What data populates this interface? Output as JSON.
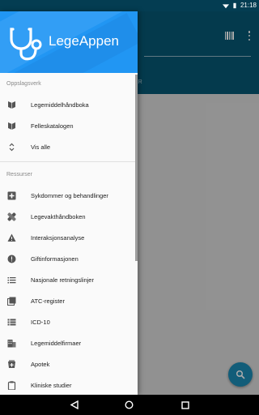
{
  "status_bar": {
    "time": "21:18"
  },
  "app": {
    "name": "LegeAppen",
    "tab_partial": "ER"
  },
  "sections": [
    {
      "label": "Oppslagsverk",
      "items": [
        {
          "label": "Legemiddelhåndboka",
          "icon": "book-open-icon"
        },
        {
          "label": "Felleskatalogen",
          "icon": "book-icon"
        },
        {
          "label": "Vis alle",
          "icon": "expand-icon"
        }
      ]
    },
    {
      "label": "Ressurser",
      "items": [
        {
          "label": "Sykdommer og behandlinger",
          "icon": "medical-cross-icon"
        },
        {
          "label": "Legevakthåndboken",
          "icon": "bandage-icon"
        },
        {
          "label": "Interaksjonsanalyse",
          "icon": "warning-icon"
        },
        {
          "label": "Giftinformasjonen",
          "icon": "alert-circle-icon"
        },
        {
          "label": "Nasjonale retningslinjer",
          "icon": "list-icon"
        },
        {
          "label": "ATC-register",
          "icon": "library-icon"
        },
        {
          "label": "ICD-10",
          "icon": "view-list-icon"
        },
        {
          "label": "Legemiddelfirmaer",
          "icon": "building-icon"
        },
        {
          "label": "Apotek",
          "icon": "pharmacy-icon"
        },
        {
          "label": "Kliniske studier",
          "icon": "clipboard-icon"
        }
      ]
    }
  ],
  "colors": {
    "header": "#2196f3",
    "appbar": "#075773",
    "statusbar": "#043d52",
    "fab": "#1b8bb5"
  }
}
